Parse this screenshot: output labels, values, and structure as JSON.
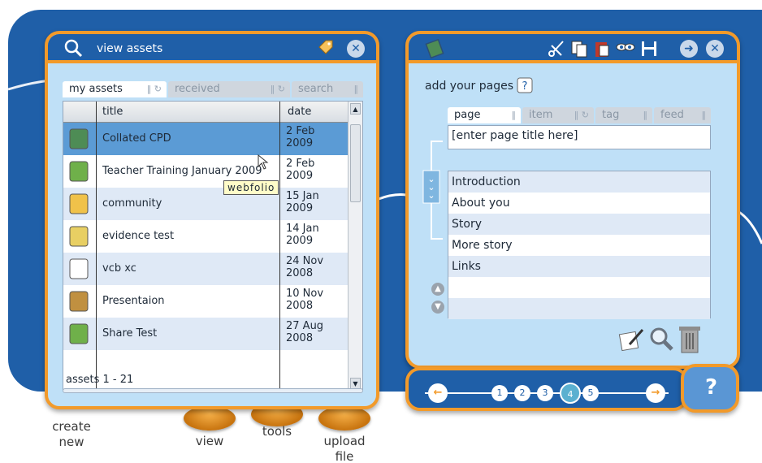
{
  "view_panel": {
    "title": "view assets",
    "tabs": [
      {
        "label": "my assets",
        "active": true
      },
      {
        "label": "received",
        "active": false
      },
      {
        "label": "search",
        "active": false
      }
    ],
    "columns": {
      "title": "title",
      "date": "date"
    },
    "rows": [
      {
        "icon": "webfolio-icon",
        "title": "Collated CPD",
        "date": "2 Feb 2009",
        "selected": true
      },
      {
        "icon": "people-icon",
        "title": "Teacher Training January 2009",
        "date": "2 Feb 2009",
        "selected": false
      },
      {
        "icon": "picture-icon",
        "title": "community",
        "date": "15 Jan 2009",
        "selected": false
      },
      {
        "icon": "evidence-icon",
        "title": "evidence test",
        "date": "14 Jan 2009",
        "selected": false
      },
      {
        "icon": "document-icon",
        "title": "vcb xc",
        "date": "24 Nov 2008",
        "selected": false
      },
      {
        "icon": "trophy-icon",
        "title": "Presentaion",
        "date": "10 Nov 2008",
        "selected": false
      },
      {
        "icon": "people-icon",
        "title": "Share Test",
        "date": "27 Aug 2008",
        "selected": false
      }
    ],
    "tooltip": "webfolio",
    "footer": "assets 1 - 21"
  },
  "pages_panel": {
    "heading": "add your pages",
    "tabs": [
      {
        "label": "page",
        "active": true
      },
      {
        "label": "item",
        "active": false
      },
      {
        "label": "tag",
        "active": false
      },
      {
        "label": "feed",
        "active": false
      }
    ],
    "title_placeholder": "[enter page title here]",
    "pages": [
      "Introduction",
      "About you",
      "Story",
      "More story",
      "Links",
      "",
      ""
    ]
  },
  "pager": {
    "pages": [
      "1",
      "2",
      "3",
      "4",
      "5"
    ],
    "current": "4",
    "help": "?"
  },
  "tools": {
    "create": "create new",
    "view": "view",
    "tools": "tools",
    "upload": "upload file"
  },
  "colors": {
    "accent": "#f29a2a",
    "brand": "#1f5fa8",
    "panel": "#bfe0f7",
    "selected": "#5b9bd5"
  }
}
